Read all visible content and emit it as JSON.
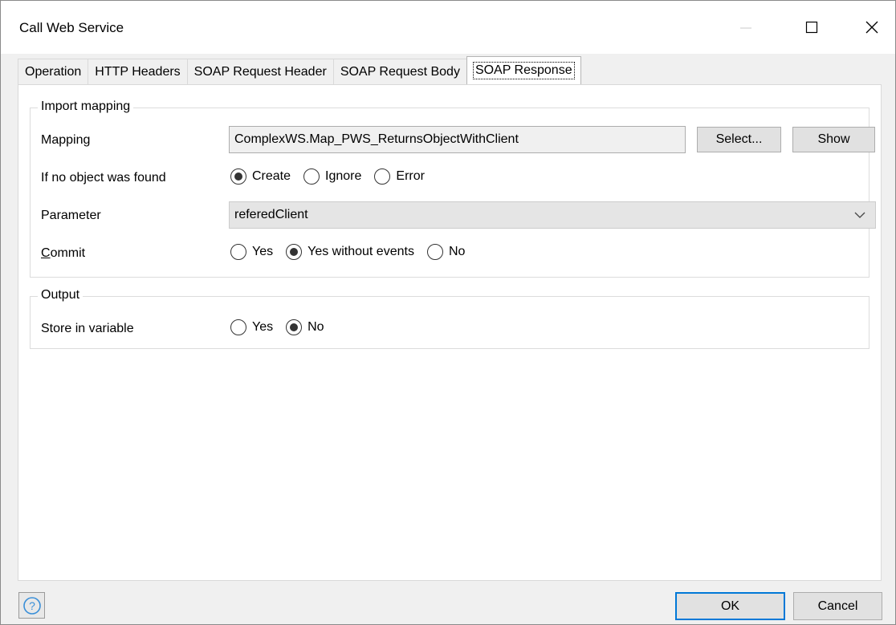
{
  "window": {
    "title": "Call Web Service"
  },
  "tabs": [
    {
      "label": "Operation"
    },
    {
      "label": "HTTP Headers"
    },
    {
      "label": "SOAP Request Header"
    },
    {
      "label": "SOAP Request Body"
    },
    {
      "label": "SOAP Response"
    }
  ],
  "import_mapping": {
    "legend": "Import mapping",
    "mapping_label": "Mapping",
    "mapping_value": "ComplexWS.Map_PWS_ReturnsObjectWithClient",
    "select_button": "Select...",
    "show_button": "Show",
    "no_object_label": "If no object was found",
    "no_object_options": [
      {
        "label": "Create",
        "selected": true
      },
      {
        "label": "Ignore",
        "selected": false
      },
      {
        "label": "Error",
        "selected": false
      }
    ],
    "parameter_label": "Parameter",
    "parameter_value": "referedClient",
    "commit_label_first": "C",
    "commit_label_rest": "ommit",
    "commit_options": [
      {
        "label": "Yes",
        "selected": false
      },
      {
        "label": "Yes without events",
        "selected": true
      },
      {
        "label": "No",
        "selected": false
      }
    ]
  },
  "output": {
    "legend": "Output",
    "store_label": "Store in variable",
    "store_options": [
      {
        "label": "Yes",
        "selected": false
      },
      {
        "label": "No",
        "selected": true
      }
    ]
  },
  "footer": {
    "help_icon": "question-circle-icon",
    "ok_label": "OK",
    "cancel_label": "Cancel"
  },
  "colors": {
    "accent": "#0078d7",
    "window_bg": "#f0f0f0",
    "help_icon": "#3a8fd8"
  }
}
